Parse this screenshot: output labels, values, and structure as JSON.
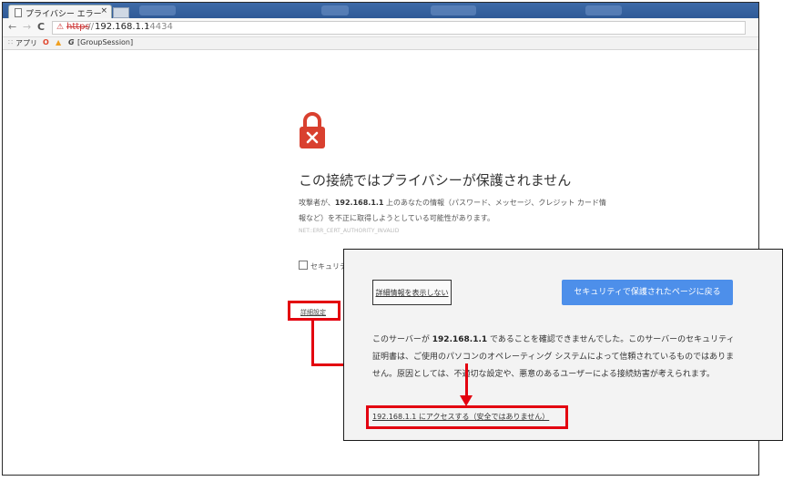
{
  "browser": {
    "tab_title": "プライバシー エラー",
    "tab_close": "×",
    "nav_back": "←",
    "nav_forward": "→",
    "nav_reload": "C",
    "url_scheme": "https",
    "url_scheme_sep": "://",
    "url_host": "192.168.1.1",
    "url_port": ":4434",
    "bookmarks": {
      "apps_label": "アプリ",
      "group_session_label": "[GroupSession]"
    }
  },
  "page": {
    "headline": "この接続ではプライバシーが保護されません",
    "desc_prefix": "攻撃者が、",
    "desc_host": "192.168.1.1",
    "desc_suffix": " 上のあなたの情報（パスワード、メッセージ、クレジット カード情報など）を不正に取得しようとしている可能性があります。",
    "error_code": "NET::ERR_CERT_AUTHORITY_INVALID",
    "checkbox_label": "セキュリテ",
    "advanced_link": "詳細設定"
  },
  "zoomed": {
    "hide_details_label": "詳細情報を表示しない",
    "back_to_safety_label": "セキュリティで保護されたページに戻る",
    "detail_prefix": "このサーバーが ",
    "detail_host": "192.168.1.1",
    "detail_suffix": " であることを確認できませんでした。このサーバーのセキュリティ証明書は、ご使用のパソコンのオペレーティング システムによって信頼されているものではありません。原因としては、不適切な設定や、悪意のあるユーザーによる接続妨害が考えられます。",
    "proceed_link": "192.168.1.1 にアクセスする（安全ではありません）"
  },
  "colors": {
    "highlight": "#e3000f",
    "padlock": "#d9402f",
    "back_button": "#4d8fea"
  },
  "icons": [
    "document-icon",
    "close-icon",
    "back-arrow-icon",
    "forward-arrow-icon",
    "reload-icon",
    "broken-lock-icon",
    "apps-grid-icon",
    "padlock-error-icon"
  ]
}
